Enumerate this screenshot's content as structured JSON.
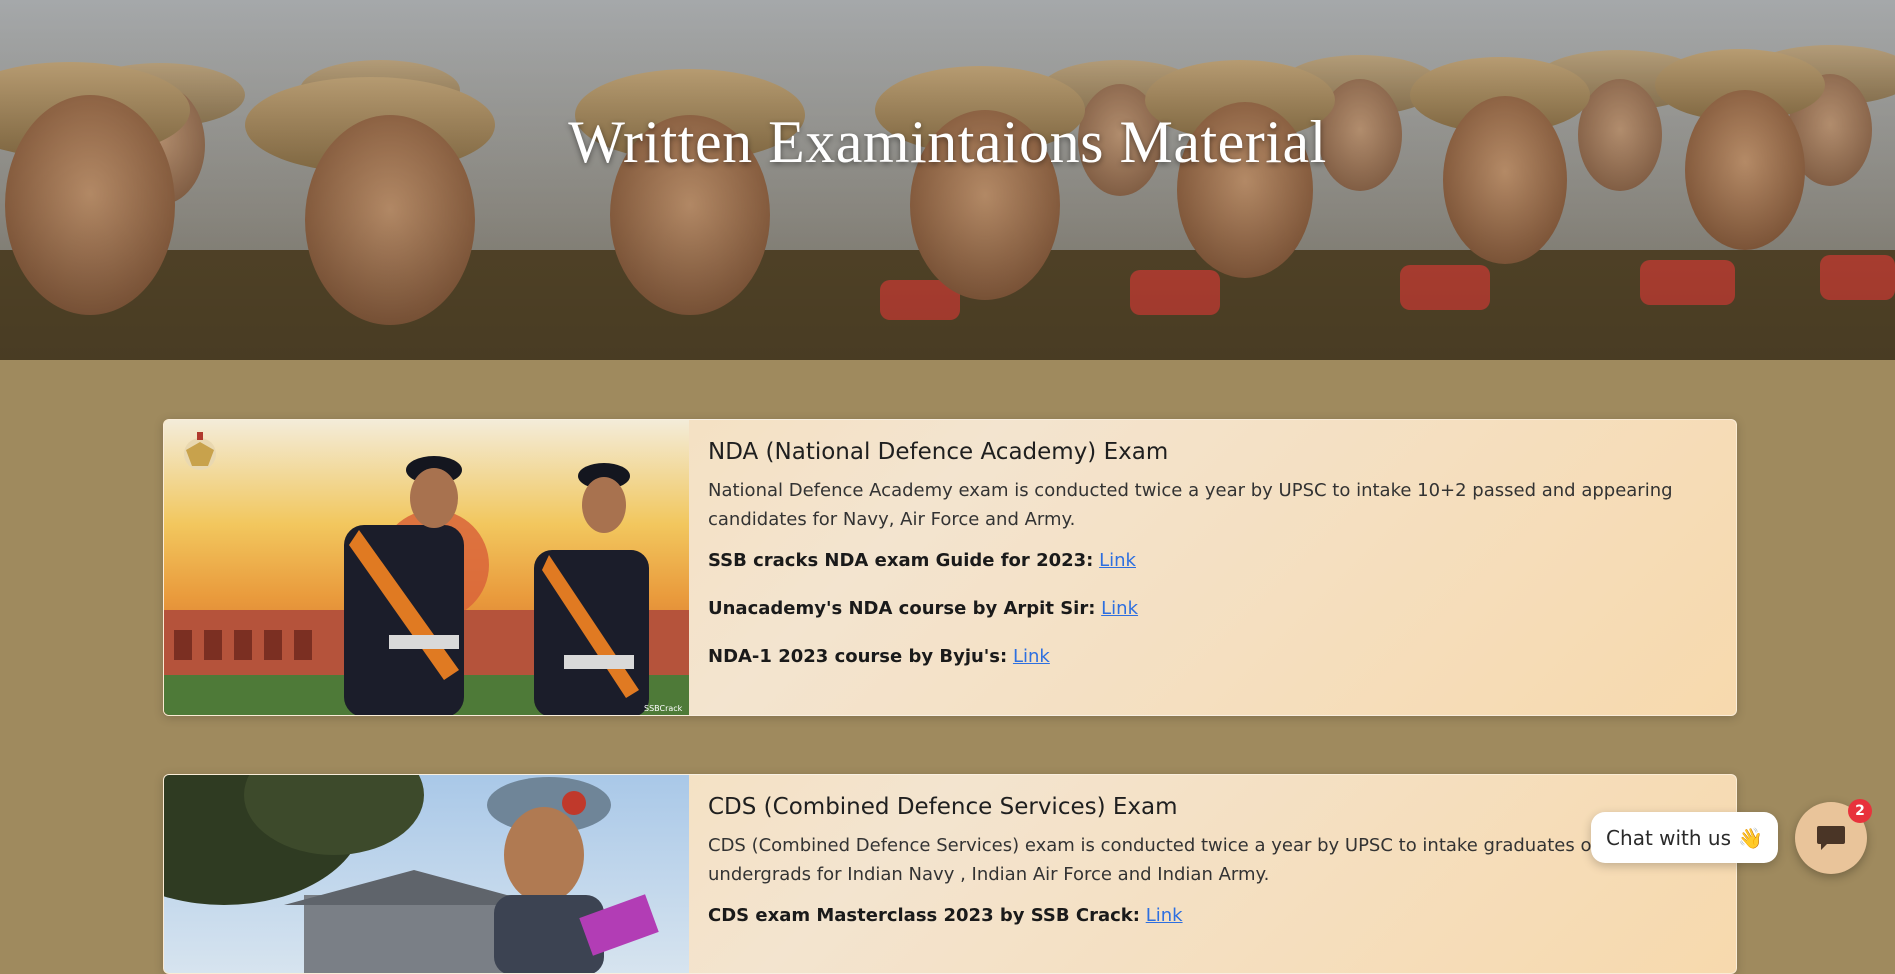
{
  "hero": {
    "title": "Written Examintaions Material"
  },
  "cards": [
    {
      "title": "NDA (National Defence Academy) Exam",
      "description": "National Defence Academy exam is conducted twice a year by UPSC to intake 10+2 passed and appearing candidates for Navy, Air Force and Army.",
      "resources": [
        {
          "label": "SSB cracks NDA exam Guide for 2023:",
          "link_text": "Link"
        },
        {
          "label": "Unacademy's NDA course by Arpit Sir:",
          "link_text": "Link"
        },
        {
          "label": "NDA-1 2023 course by Byju's:",
          "link_text": "Link"
        }
      ],
      "image_watermark": "SSBCrack"
    },
    {
      "title": "CDS (Combined Defence Services) Exam",
      "description": "CDS (Combined Defence Services) exam is conducted twice a year by UPSC to intake graduates or final year undergrads for Indian Navy , Indian Air Force and Indian Army.",
      "resources": [
        {
          "label": "CDS exam Masterclass 2023 by SSB Crack:",
          "link_text": "Link"
        }
      ]
    }
  ],
  "chat": {
    "prompt": "Chat with us",
    "wave_emoji": "👋",
    "unread_count": "2",
    "launcher_icon": "chat-bubble-icon"
  },
  "colors": {
    "page_background": "#9f8a5e",
    "link": "#2d6fe0",
    "badge": "#e8323c",
    "chat_launcher": "#e9c49a"
  }
}
